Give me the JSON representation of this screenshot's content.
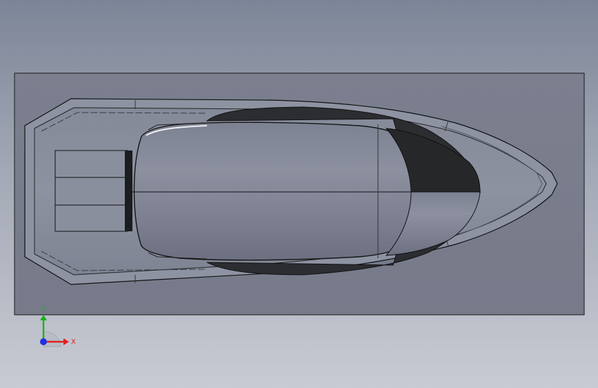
{
  "axes": {
    "y_label": "Y",
    "x_label": "X"
  },
  "colors": {
    "background_top": "#7c8597",
    "background_bottom": "#c8cbd3",
    "plate": "#7a7f8e",
    "hull_body": "#8b909e",
    "canopy_dark": "#2a2b2e",
    "axis_x": "#e02020",
    "axis_y": "#20b020",
    "axis_z": "#2030e0"
  },
  "icons": {
    "triad": "coordinate-triad-icon"
  }
}
